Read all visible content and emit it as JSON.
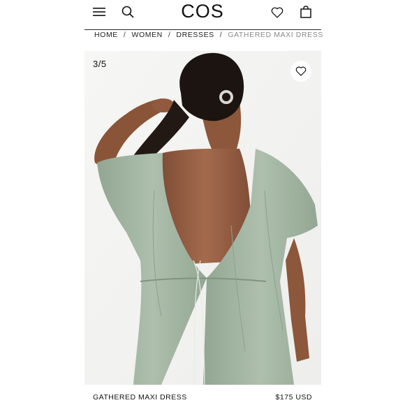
{
  "header": {
    "logo": "COS",
    "menu_icon": "hamburger-menu-icon",
    "search_icon": "search-icon",
    "wishlist_icon": "heart-icon",
    "bag_icon": "shopping-bag-icon"
  },
  "breadcrumb": {
    "items": [
      "HOME",
      "WOMEN",
      "DRESSES",
      "GATHERED MAXI DRESS"
    ],
    "separator": "/"
  },
  "gallery": {
    "counter": "3/5",
    "favorite_icon": "heart-icon",
    "progress": {
      "current": 3,
      "total": 5
    }
  },
  "product": {
    "name": "GATHERED MAXI DRESS",
    "price": "$175 USD"
  },
  "colors": {
    "dress": "#a9bba8",
    "background": "#f3f3f1",
    "text": "#111111",
    "breadcrumb_current": "#8a8a8a"
  }
}
